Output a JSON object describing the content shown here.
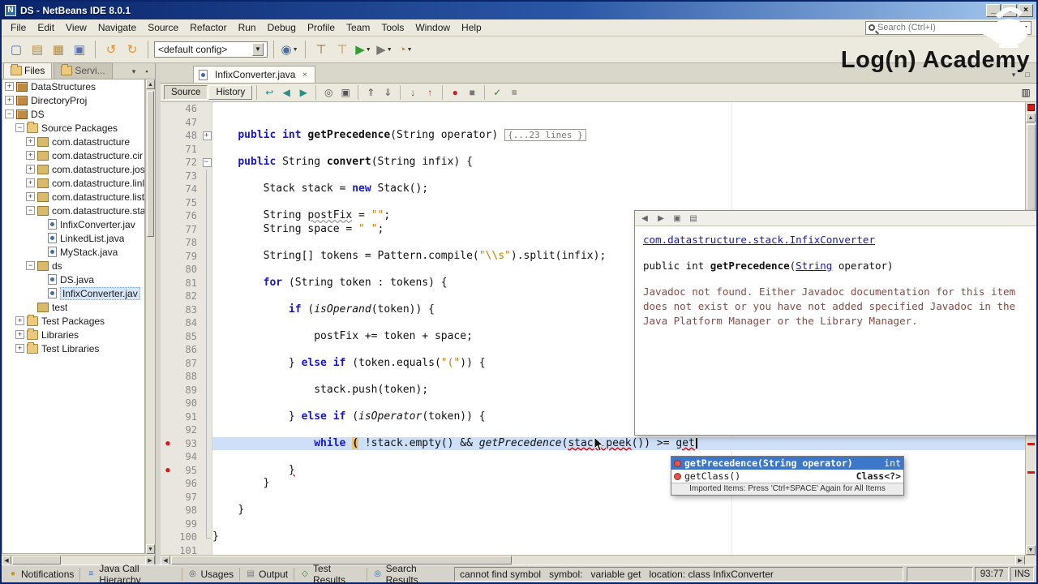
{
  "window": {
    "title": "DS - NetBeans IDE 8.0.1",
    "minimize": "_",
    "maximize": "□",
    "close": "×"
  },
  "brand": {
    "name": "Log(n) Academy"
  },
  "menubar": {
    "items": [
      "File",
      "Edit",
      "View",
      "Navigate",
      "Source",
      "Refactor",
      "Run",
      "Debug",
      "Profile",
      "Team",
      "Tools",
      "Window",
      "Help"
    ]
  },
  "search": {
    "placeholder": "Search (Ctrl+I)"
  },
  "toolbar": {
    "config": "<default config>",
    "icons": [
      {
        "name": "new-file",
        "glyph": "▢",
        "color": "#5b6fae"
      },
      {
        "name": "new-project",
        "glyph": "▤",
        "color": "#b5893c"
      },
      {
        "name": "open-project",
        "glyph": "▦",
        "color": "#b5893c"
      },
      {
        "name": "save-all",
        "glyph": "▣",
        "color": "#5b6fae"
      },
      {
        "name": "sep"
      },
      {
        "name": "undo",
        "glyph": "↺",
        "color": "#e08f2d"
      },
      {
        "name": "redo",
        "glyph": "↻",
        "color": "#e08f2d"
      },
      {
        "name": "sep"
      },
      {
        "name": "config"
      },
      {
        "name": "sep"
      },
      {
        "name": "deploy",
        "glyph": "◉",
        "color": "#4a6f9e",
        "arrow": true
      },
      {
        "name": "sep"
      },
      {
        "name": "build",
        "glyph": "⊤",
        "color": "#8a5a2a"
      },
      {
        "name": "clean-build",
        "glyph": "⊤",
        "color": "#b5893c"
      },
      {
        "name": "run",
        "glyph": "▶",
        "color": "#2f9e2f",
        "arrow": true
      },
      {
        "name": "debug",
        "glyph": "▶",
        "color": "#777777",
        "arrow": true
      },
      {
        "name": "profile",
        "glyph": "◔",
        "color": "#b5893c",
        "arrow": true
      }
    ]
  },
  "sidebar": {
    "tabs": [
      {
        "label": "Files",
        "active": true
      },
      {
        "label": "Servi...",
        "active": false
      }
    ],
    "tree": [
      {
        "label": "DataStructures",
        "lvl": 0,
        "exp": "+",
        "icon": "project"
      },
      {
        "label": "DirectoryProj",
        "lvl": 0,
        "exp": "+",
        "icon": "project"
      },
      {
        "label": "DS",
        "lvl": 0,
        "exp": "-",
        "icon": "project"
      },
      {
        "label": "Source Packages",
        "lvl": 1,
        "exp": "-",
        "icon": "srcfolder"
      },
      {
        "label": "com.datastructure",
        "lvl": 2,
        "exp": "+",
        "icon": "package"
      },
      {
        "label": "com.datastructure.cir",
        "lvl": 2,
        "exp": "+",
        "icon": "package"
      },
      {
        "label": "com.datastructure.jos",
        "lvl": 2,
        "exp": "+",
        "icon": "package"
      },
      {
        "label": "com.datastructure.linl",
        "lvl": 2,
        "exp": "+",
        "icon": "package"
      },
      {
        "label": "com.datastructure.list",
        "lvl": 2,
        "exp": "+",
        "icon": "package"
      },
      {
        "label": "com.datastructure.sta",
        "lvl": 2,
        "exp": "-",
        "icon": "package"
      },
      {
        "label": "InfixConverter.jav",
        "lvl": 3,
        "icon": "java"
      },
      {
        "label": "LinkedList.java",
        "lvl": 3,
        "icon": "java"
      },
      {
        "label": "MyStack.java",
        "lvl": 3,
        "icon": "java"
      },
      {
        "label": "ds",
        "lvl": 2,
        "exp": "-",
        "icon": "package"
      },
      {
        "label": "DS.java",
        "lvl": 3,
        "icon": "java"
      },
      {
        "label": "InfixConverter.jav",
        "lvl": 3,
        "icon": "java",
        "selected": true
      },
      {
        "label": "test",
        "lvl": 2,
        "icon": "package"
      },
      {
        "label": "Test Packages",
        "lvl": 1,
        "exp": "+",
        "icon": "srcfolder"
      },
      {
        "label": "Libraries",
        "lvl": 1,
        "exp": "+",
        "icon": "libfolder"
      },
      {
        "label": "Test Libraries",
        "lvl": 1,
        "exp": "+",
        "icon": "libfolder"
      }
    ]
  },
  "editor": {
    "tab": {
      "title": "InfixConverter.java",
      "close": "×"
    },
    "toolbar": {
      "source": "Source",
      "history": "History",
      "icons": [
        {
          "name": "last-edited",
          "glyph": "↩",
          "color": "#2e8b8b"
        },
        {
          "name": "back",
          "glyph": "◀",
          "color": "#2e8b8b"
        },
        {
          "name": "forward",
          "glyph": "▶",
          "color": "#2e8b8b"
        },
        {
          "name": "sep"
        },
        {
          "name": "find-selection",
          "glyph": "◎",
          "color": "#555555"
        },
        {
          "name": "find-occurrences",
          "glyph": "▣",
          "color": "#555555"
        },
        {
          "name": "sep"
        },
        {
          "name": "prev-bookmark",
          "glyph": "⇑",
          "color": "#555555"
        },
        {
          "name": "next-bookmark",
          "glyph": "⇓",
          "color": "#555555"
        },
        {
          "name": "sep"
        },
        {
          "name": "next-error",
          "glyph": "↓",
          "color": "#a33333"
        },
        {
          "name": "prev-error",
          "glyph": "↑",
          "color": "#a33333"
        },
        {
          "name": "sep"
        },
        {
          "name": "record-macro",
          "glyph": "●",
          "color": "#c22222"
        },
        {
          "name": "stop-macro",
          "glyph": "■",
          "color": "#777777"
        },
        {
          "name": "sep"
        },
        {
          "name": "comment",
          "glyph": "✓",
          "color": "#2f7e2f"
        },
        {
          "name": "uncomment",
          "glyph": "≡",
          "color": "#555555"
        }
      ]
    },
    "lines": [
      {
        "n": 46
      },
      {
        "n": 47
      },
      {
        "n": 48,
        "fold": "+",
        "ind": 4,
        "t": [
          [
            "k",
            "public"
          ],
          [
            "p",
            " "
          ],
          [
            "k",
            "int"
          ],
          [
            "p",
            " "
          ],
          [
            "b",
            "getPrecedence"
          ],
          [
            "p",
            "(String operator) "
          ],
          [
            "bg",
            "{...23 lines }"
          ]
        ]
      },
      {
        "n": 71
      },
      {
        "n": 72,
        "fold": "-",
        "ind": 4,
        "t": [
          [
            "k",
            "public"
          ],
          [
            "p",
            " String "
          ],
          [
            "b",
            "convert"
          ],
          [
            "p",
            "(String infix) {"
          ]
        ]
      },
      {
        "n": 73,
        "fold": "|"
      },
      {
        "n": 74,
        "fold": "|",
        "ind": 8,
        "t": [
          [
            "p",
            "Stack stack = "
          ],
          [
            "k",
            "new"
          ],
          [
            "p",
            " Stack();"
          ]
        ]
      },
      {
        "n": 75,
        "fold": "|"
      },
      {
        "n": 76,
        "fold": "|",
        "ind": 8,
        "t": [
          [
            "p",
            "String "
          ],
          [
            "wv",
            "postFix"
          ],
          [
            "p",
            " = "
          ],
          [
            "s",
            "\"\""
          ],
          [
            "p",
            ";"
          ]
        ]
      },
      {
        "n": 77,
        "fold": "|",
        "ind": 8,
        "t": [
          [
            "p",
            "String space = "
          ],
          [
            "s",
            "\" \""
          ],
          [
            "p",
            ";"
          ]
        ]
      },
      {
        "n": 78,
        "fold": "|"
      },
      {
        "n": 79,
        "fold": "|",
        "ind": 8,
        "t": [
          [
            "p",
            "String[] tokens = Pattern.compile("
          ],
          [
            "s",
            "\"\\\\s\""
          ],
          [
            "p",
            ").split(infix);"
          ]
        ]
      },
      {
        "n": 80,
        "fold": "|"
      },
      {
        "n": 81,
        "fold": "|",
        "ind": 8,
        "t": [
          [
            "k",
            "for"
          ],
          [
            "p",
            " (String token : tokens) {"
          ]
        ]
      },
      {
        "n": 82,
        "fold": "|"
      },
      {
        "n": 83,
        "fold": "|",
        "ind": 12,
        "t": [
          [
            "k",
            "if"
          ],
          [
            "p",
            " ("
          ],
          [
            "i",
            "isOperand"
          ],
          [
            "p",
            "(token)) {"
          ]
        ]
      },
      {
        "n": 84,
        "fold": "|"
      },
      {
        "n": 85,
        "fold": "|",
        "ind": 16,
        "t": [
          [
            "p",
            "postFix += token + space;"
          ]
        ]
      },
      {
        "n": 86,
        "fold": "|"
      },
      {
        "n": 87,
        "fold": "|",
        "ind": 12,
        "t": [
          [
            "p",
            "} "
          ],
          [
            "k",
            "else"
          ],
          [
            "p",
            " "
          ],
          [
            "k",
            "if"
          ],
          [
            "p",
            " (token.equals("
          ],
          [
            "s",
            "\"(\""
          ],
          [
            "p",
            ")) {"
          ]
        ]
      },
      {
        "n": 88,
        "fold": "|"
      },
      {
        "n": 89,
        "fold": "|",
        "ind": 16,
        "t": [
          [
            "p",
            "stack.push(token);"
          ]
        ]
      },
      {
        "n": 90,
        "fold": "|"
      },
      {
        "n": 91,
        "fold": "|",
        "ind": 12,
        "t": [
          [
            "p",
            "} "
          ],
          [
            "k",
            "else"
          ],
          [
            "p",
            " "
          ],
          [
            "k",
            "if"
          ],
          [
            "p",
            " ("
          ],
          [
            "i",
            "isOperator"
          ],
          [
            "p",
            "(token)) {"
          ]
        ]
      },
      {
        "n": 92,
        "fold": "|"
      },
      {
        "n": 93,
        "fold": "|",
        "ind": 16,
        "err": true,
        "cur": true,
        "caret": true,
        "t": [
          [
            "k",
            "while"
          ],
          [
            "p",
            " "
          ],
          [
            "pm",
            "("
          ],
          [
            "p",
            " !stack.empty() && "
          ],
          [
            "i",
            "getPrecedence"
          ],
          [
            "p",
            "("
          ],
          [
            "er",
            "stack.peek"
          ],
          [
            "p",
            "()) >= "
          ],
          [
            "er",
            "get"
          ]
        ]
      },
      {
        "n": 94,
        "fold": "|"
      },
      {
        "n": 95,
        "fold": "|",
        "ind": 12,
        "err": true,
        "t": [
          [
            "er",
            "}"
          ]
        ]
      },
      {
        "n": 96,
        "fold": "|",
        "ind": 8,
        "t": [
          [
            "p",
            "}"
          ]
        ]
      },
      {
        "n": 97,
        "fold": "|"
      },
      {
        "n": 98,
        "fold": "|",
        "ind": 4,
        "t": [
          [
            "p",
            "}"
          ]
        ]
      },
      {
        "n": 99,
        "fold": "|"
      },
      {
        "n": 100,
        "fold": "L",
        "t": [
          [
            "p",
            "}"
          ]
        ]
      },
      {
        "n": 101
      }
    ]
  },
  "javadoc": {
    "icons": [
      {
        "name": "javadoc-back",
        "glyph": "◀"
      },
      {
        "name": "javadoc-forward",
        "glyph": "▶"
      },
      {
        "name": "show-in-browser",
        "glyph": "▣"
      },
      {
        "name": "copy-to-clipboard",
        "glyph": "▤"
      }
    ],
    "link": "com.datastructure.stack.InfixConverter",
    "sig": [
      [
        "p",
        "public int "
      ],
      [
        "b",
        "getPrecedence"
      ],
      [
        "p",
        "("
      ],
      [
        "l",
        "String"
      ],
      [
        "p",
        " operator)"
      ]
    ],
    "body": "Javadoc not found. Either Javadoc documentation for this item does not exist or you have not added specified Javadoc in the Java Platform Manager or the Library Manager."
  },
  "completion": {
    "items": [
      {
        "label": "getPrecedence(String operator)",
        "type": "int",
        "selected": true
      },
      {
        "label": "getClass()",
        "type": "Class<?>",
        "selected": false
      }
    ],
    "footer": "Imported Items: Press 'Ctrl+SPACE' Again for All Items"
  },
  "statusbar": {
    "panels": [
      {
        "label": "Notifications",
        "icon": "bell"
      },
      {
        "label": "Java Call Hierarchy",
        "icon": "hierarchy"
      },
      {
        "label": "Usages",
        "icon": "usages"
      },
      {
        "label": "Output",
        "icon": "output"
      },
      {
        "label": "Test Results",
        "icon": "test"
      },
      {
        "label": "Search Results",
        "icon": "search"
      }
    ],
    "message": "cannot find symbol   symbol:   variable get   location: class InfixConverter",
    "position": "93:77",
    "mode": "INS"
  }
}
